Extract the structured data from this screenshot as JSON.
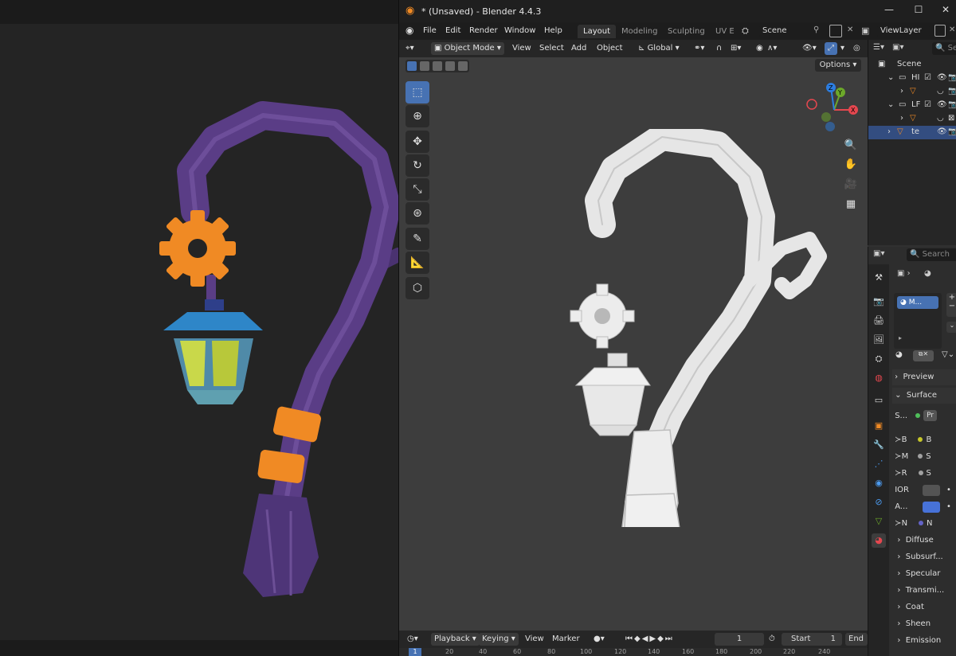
{
  "window": {
    "title": "* (Unsaved) - Blender 4.4.3",
    "controls": [
      "—",
      "☐",
      "✕"
    ]
  },
  "menu": [
    "File",
    "Edit",
    "Render",
    "Window",
    "Help"
  ],
  "workspaces": [
    "Layout",
    "Modeling",
    "Sculpting",
    "UV E"
  ],
  "scene_field": "Scene",
  "viewlayer_field": "ViewLayer",
  "viewport_header": {
    "mode": "Object Mode",
    "menus": [
      "View",
      "Select",
      "Add",
      "Object"
    ],
    "transform_orientation": "Global",
    "options_label": "Options"
  },
  "toolbar_icons": [
    "select-box-icon",
    "cursor-icon",
    "move-icon",
    "rotate-icon",
    "scale-icon",
    "transform-icon",
    "annotate-icon",
    "measure-icon",
    "add-cube-icon"
  ],
  "gizmo": {
    "x": "X",
    "y": "Y",
    "z": "Z"
  },
  "outliner": {
    "search_placeholder": "Se",
    "rows": [
      {
        "label": "Scene"
      },
      {
        "label": "HI"
      },
      {
        "label": ""
      },
      {
        "label": "LF"
      },
      {
        "label": ""
      },
      {
        "label": "te"
      }
    ]
  },
  "properties": {
    "search_placeholder": "Search",
    "material_slot": "M...",
    "preview_label": "Preview",
    "surface_label": "Surface",
    "rows": [
      {
        "label": "S...",
        "value": "Pr",
        "socket_color": "#4fbf5a"
      },
      {
        "label": "B",
        "value": "B",
        "socket_color": "#c7c729"
      },
      {
        "label": "M",
        "value": "S",
        "socket_color": "#a1a1a1"
      },
      {
        "label": "R",
        "value": "S",
        "socket_color": "#a1a1a1"
      },
      {
        "label": "IOR",
        "value": "",
        "socket_color": "#a1a1a1"
      },
      {
        "label": "A...",
        "value": "",
        "socket_color": "#a1a1a1"
      },
      {
        "label": "N",
        "value": "N",
        "socket_color": "#6363c7"
      }
    ],
    "subpanels": [
      "Diffuse",
      "Subsurf...",
      "Specular",
      "Transmi...",
      "Coat",
      "Sheen",
      "Emission"
    ]
  },
  "timeline": {
    "menus": [
      "Playback",
      "Keying",
      "View",
      "Marker"
    ],
    "current_frame": "1",
    "start_label": "Start",
    "start_value": "1",
    "end_label": "End",
    "ruler_ticks": [
      "1",
      "20",
      "40",
      "60",
      "80",
      "100",
      "120",
      "140",
      "160",
      "180",
      "200",
      "220",
      "240"
    ]
  },
  "colors": {
    "accent": "#4772b3",
    "viewport_bg": "#3d3d3d",
    "lamp_purple": "#5a3d86",
    "lamp_orange": "#f08a24",
    "lamp_blue": "#2e86c8",
    "glass": "#c9d84a"
  }
}
